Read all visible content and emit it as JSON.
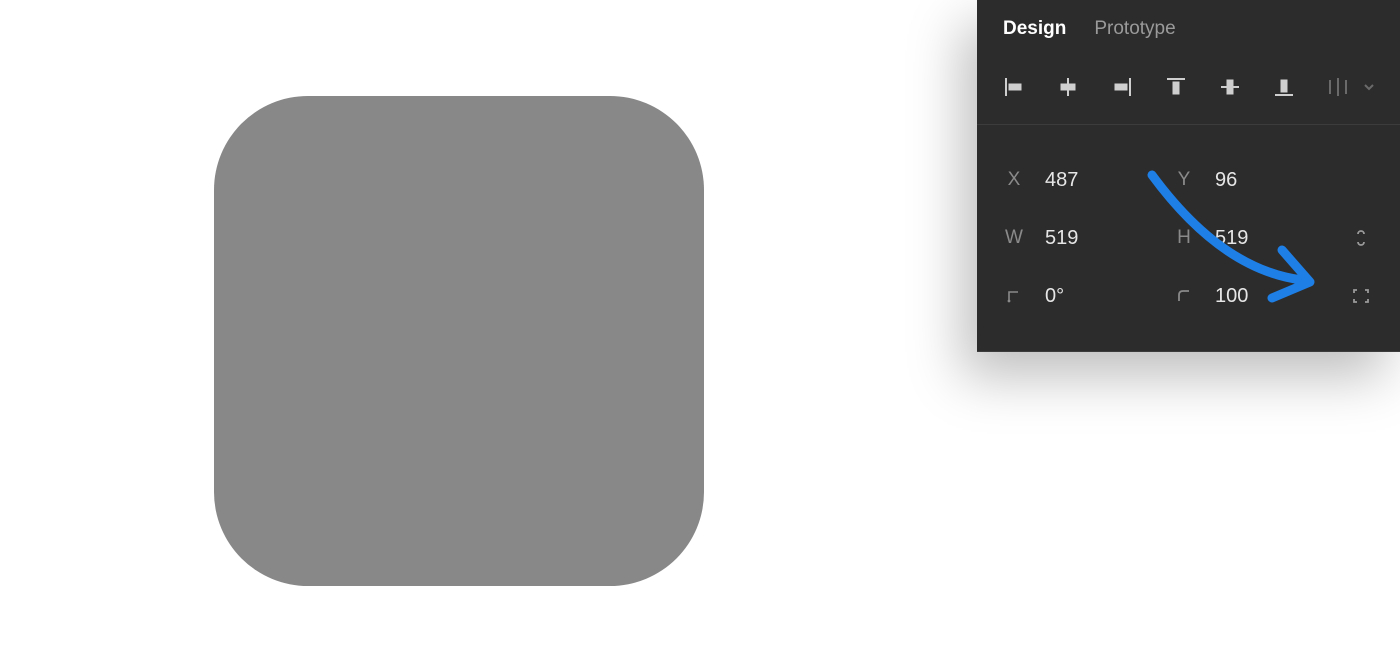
{
  "canvas": {
    "shape_fill": "#888888",
    "corner_radius_px": 94
  },
  "panel": {
    "tabs": {
      "design": "Design",
      "prototype": "Prototype",
      "active": "design"
    },
    "properties": {
      "x": {
        "label": "X",
        "value": "487"
      },
      "y": {
        "label": "Y",
        "value": "96"
      },
      "w": {
        "label": "W",
        "value": "519"
      },
      "h": {
        "label": "H",
        "value": "519"
      },
      "rotation": {
        "value": "0°"
      },
      "corner_radius": {
        "value": "100"
      }
    }
  },
  "annotation": {
    "arrow_color": "#1E7FE6"
  }
}
